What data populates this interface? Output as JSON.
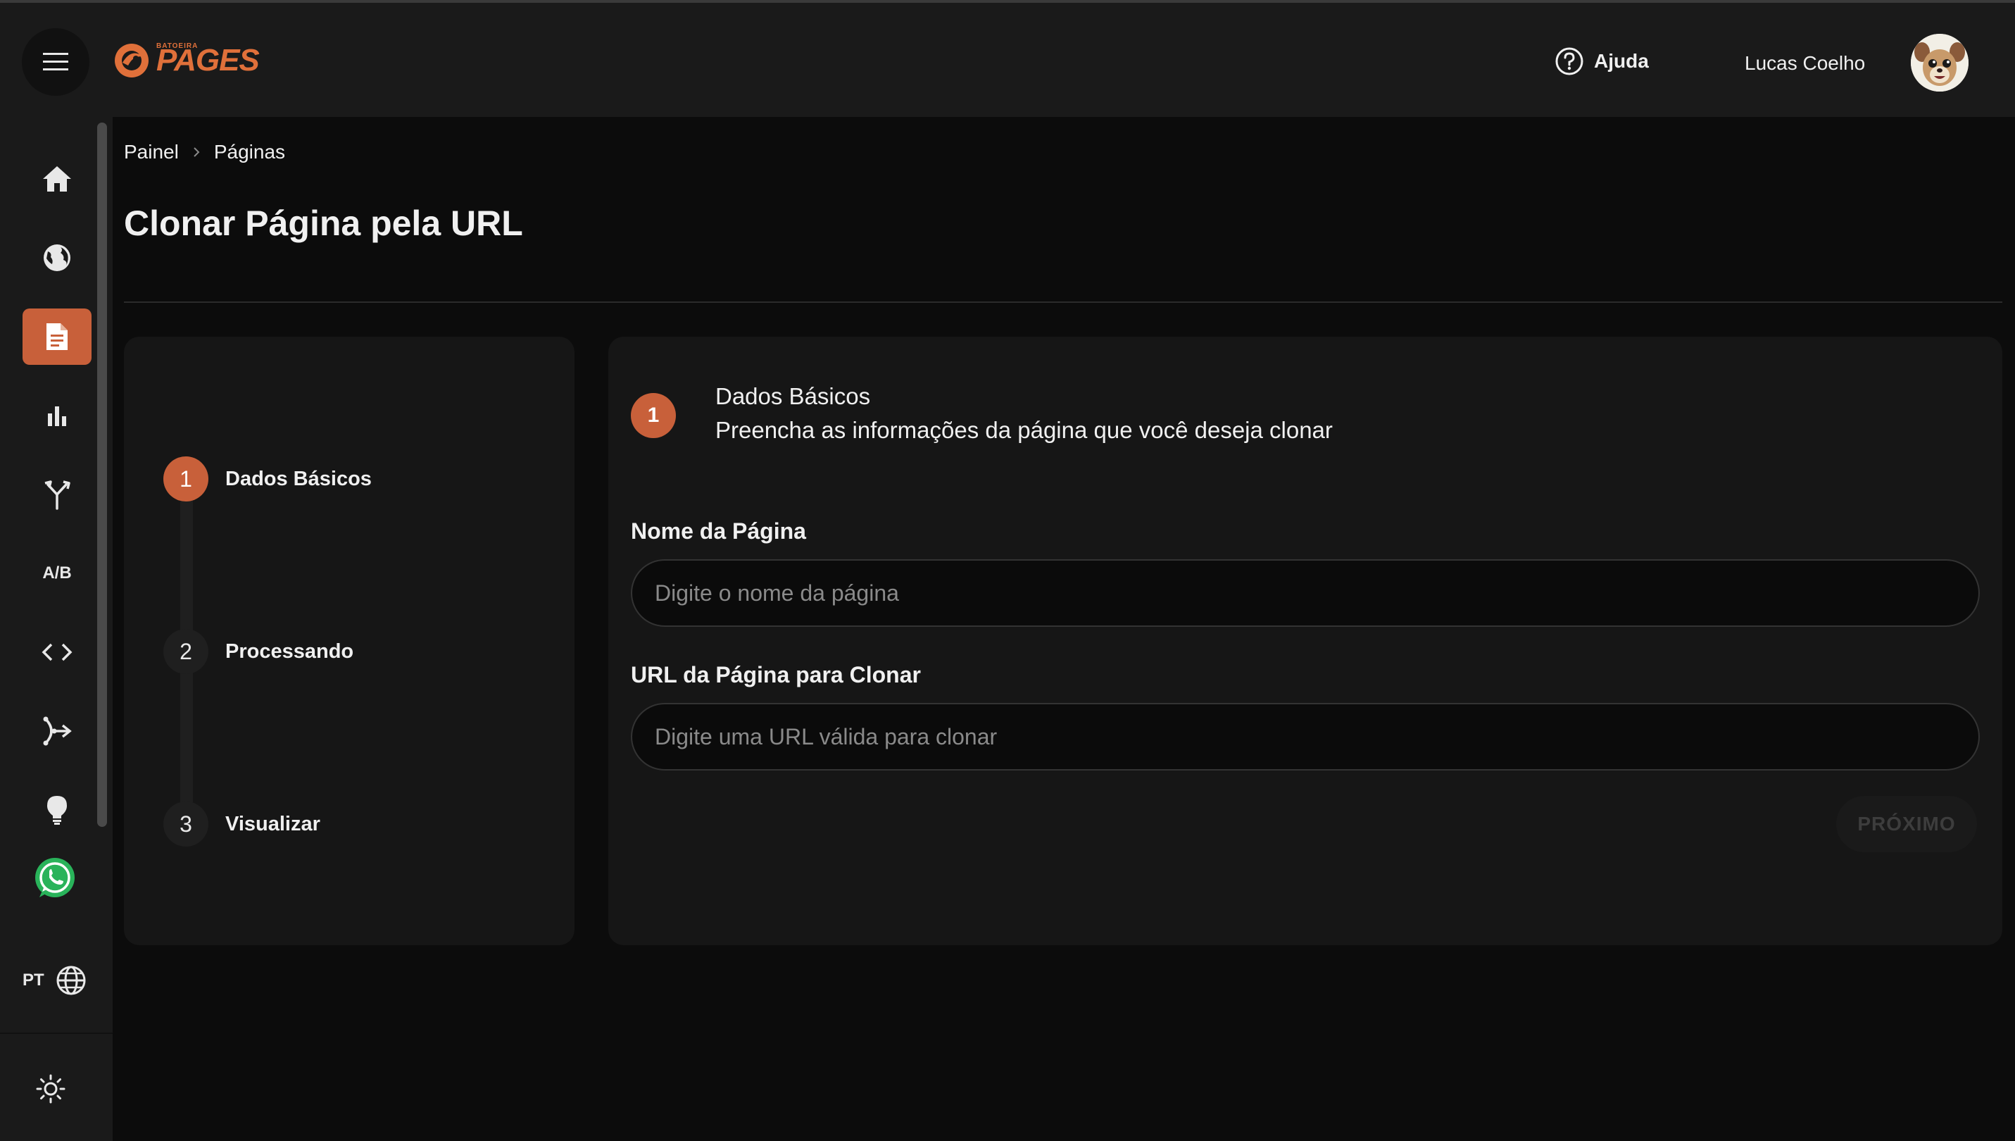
{
  "header": {
    "logo_small": "BATOEIRA",
    "logo_text": "PAGES",
    "help_label": "Ajuda",
    "user_name": "Lucas Coelho"
  },
  "sidebar": {
    "items": [
      {
        "name": "home",
        "icon": "home-icon"
      },
      {
        "name": "domains",
        "icon": "globe-icon"
      },
      {
        "name": "pages",
        "icon": "document-icon",
        "active": true
      },
      {
        "name": "analytics",
        "icon": "bar-chart-icon"
      },
      {
        "name": "funnels",
        "icon": "split-icon"
      },
      {
        "name": "ab-tests",
        "label": "A/B"
      },
      {
        "name": "scripts",
        "icon": "code-icon"
      },
      {
        "name": "integrations",
        "icon": "webhook-icon"
      },
      {
        "name": "ideas",
        "icon": "lightbulb-icon"
      },
      {
        "name": "whatsapp",
        "icon": "whatsapp-icon"
      }
    ],
    "language": "PT"
  },
  "breadcrumb": {
    "items": [
      "Painel",
      "Páginas"
    ]
  },
  "page_title": "Clonar Página pela URL",
  "stepper": {
    "steps": [
      {
        "number": "1",
        "label": "Dados Básicos",
        "active": true
      },
      {
        "number": "2",
        "label": "Processando"
      },
      {
        "number": "3",
        "label": "Visualizar"
      }
    ]
  },
  "form": {
    "step_number": "1",
    "step_title": "Dados Básicos",
    "step_description": "Preencha as informações da página que você deseja clonar",
    "name_label": "Nome da Página",
    "name_placeholder": "Digite o nome da página",
    "name_value": "",
    "url_label": "URL da Página para Clonar",
    "url_placeholder": "Digite uma URL válida para clonar",
    "url_value": "",
    "next_label": "PRÓXIMO"
  },
  "colors": {
    "accent": "#c8603a",
    "background": "#0c0c0c",
    "panel": "#1a1a1a",
    "card": "#161616"
  }
}
